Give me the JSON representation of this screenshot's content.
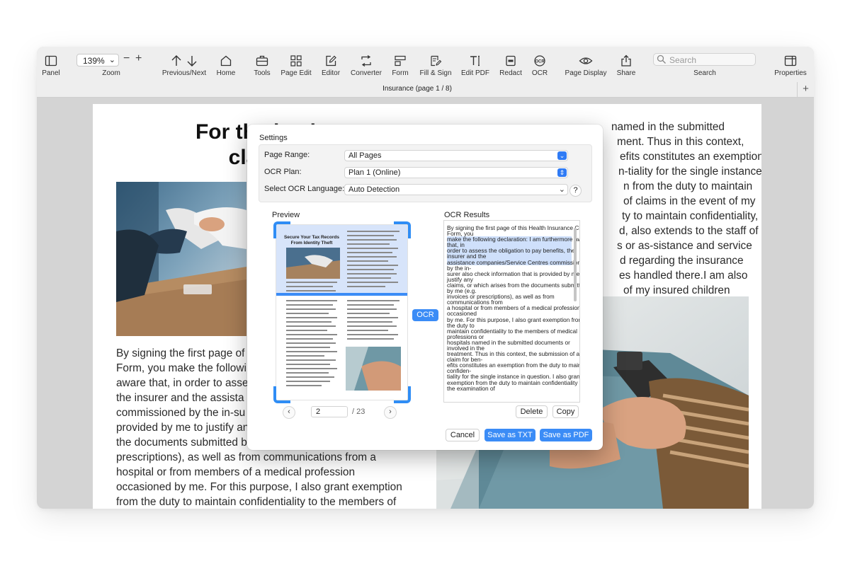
{
  "toolbar": {
    "panel": "Panel",
    "zoom_value": "139%",
    "zoom": "Zoom",
    "prev_next": "Previous/Next",
    "home": "Home",
    "tools": "Tools",
    "page_edit": "Page Edit",
    "editor": "Editor",
    "converter": "Converter",
    "form": "Form",
    "fill_sign": "Fill & Sign",
    "edit_pdf": "Edit PDF",
    "redact": "Redact",
    "ocr": "OCR",
    "page_display": "Page Display",
    "share": "Share",
    "search_placeholder": "Search",
    "search": "Search",
    "properties": "Properties"
  },
  "tab": {
    "title": "Insurance (page 1 / 8)"
  },
  "document": {
    "heading_line1": "For the heal",
    "heading_line2": "claim",
    "left_body": [
      "By signing the first page of",
      "Form, you make the followi",
      "aware that, in order to asse",
      "the insurer and the assista",
      "commissioned by the in-su",
      "provided by me to justify an",
      "the documents submitted b",
      "prescriptions), as well as from communications from a",
      "hospital or from members of a medical profession",
      "occasioned by me. For this purpose, I also grant exemption",
      "from the duty to maintain confidentiality to the members of"
    ],
    "right_body": [
      "named in the submitted",
      "ment. Thus in this context,",
      "efits constitutes an exemption",
      "n-tiality for the single instance",
      "n from the duty to maintain",
      "of claims in the event of my",
      "ty to maintain confidentiality,",
      "d, also extends to the staff of",
      "s or as-sistance and service",
      "d regarding the insurance",
      "es handled there.I am also",
      "of my insured children"
    ]
  },
  "dialog": {
    "settings_title": "Settings",
    "page_range_label": "Page Range:",
    "page_range_value": "All Pages",
    "ocr_plan_label": "OCR Plan:",
    "ocr_plan_value": "Plan 1 (Online)",
    "language_label": "Select OCR Language:",
    "language_value": "Auto Detection",
    "help": "?",
    "preview_label": "Preview",
    "results_label": "OCR Results",
    "ocr_button": "OCR",
    "page_input": "2",
    "page_total": "/ 23",
    "delete": "Delete",
    "copy": "Copy",
    "cancel": "Cancel",
    "save_txt": "Save as TXT",
    "save_pdf": "Save as PDF"
  },
  "preview_page": {
    "title_line1": "Secure Your Tax Records",
    "title_line2": "From Identity Theft"
  },
  "ocr_results": [
    {
      "t": "By signing the first page of this Health Insurance Claim",
      "h": false
    },
    {
      "t": "Form, you",
      "h": false
    },
    {
      "t": "make the following declaration: I am furthermore aware",
      "h": true
    },
    {
      "t": "that, in",
      "h": true
    },
    {
      "t": "order to assess the obligation to pay benefits, the",
      "h": true
    },
    {
      "t": "insurer and the",
      "h": true
    },
    {
      "t": "assistance companies/Service Centres commissioned",
      "h": true
    },
    {
      "t": "by the in-",
      "h": false
    },
    {
      "t": "surer also check information that is provided by me to",
      "h": false
    },
    {
      "t": "justify any",
      "h": false
    },
    {
      "t": "claims, or which arises from the documents submitted",
      "h": false
    },
    {
      "t": "by me (e.g.",
      "h": false
    },
    {
      "t": "invoices or prescriptions), as well as from",
      "h": false
    },
    {
      "t": "communications from",
      "h": false
    },
    {
      "t": "a hospital or from members of a medical profession",
      "h": false
    },
    {
      "t": "occasioned",
      "h": false
    },
    {
      "t": "by me. For this purpose, I also grant exemption from",
      "h": false
    },
    {
      "t": "the duty to",
      "h": false
    },
    {
      "t": "maintain confidentiality to the members of medical",
      "h": false
    },
    {
      "t": "professions or",
      "h": false
    },
    {
      "t": "hospitals named in the submitted documents or",
      "h": false
    },
    {
      "t": "involved in the",
      "h": false
    },
    {
      "t": "treatment. Thus in this context, the submission of a",
      "h": false
    },
    {
      "t": "claim for ben-",
      "h": false
    },
    {
      "t": "efits constitutes an exemption from the duty to maintain",
      "h": false
    },
    {
      "t": "confiden-",
      "h": false
    },
    {
      "t": "tiality for the single instance in question. I also grant",
      "h": false
    },
    {
      "t": "exemption from the duty to maintain confidentiality for",
      "h": false
    },
    {
      "t": "the examination of",
      "h": false
    }
  ]
}
